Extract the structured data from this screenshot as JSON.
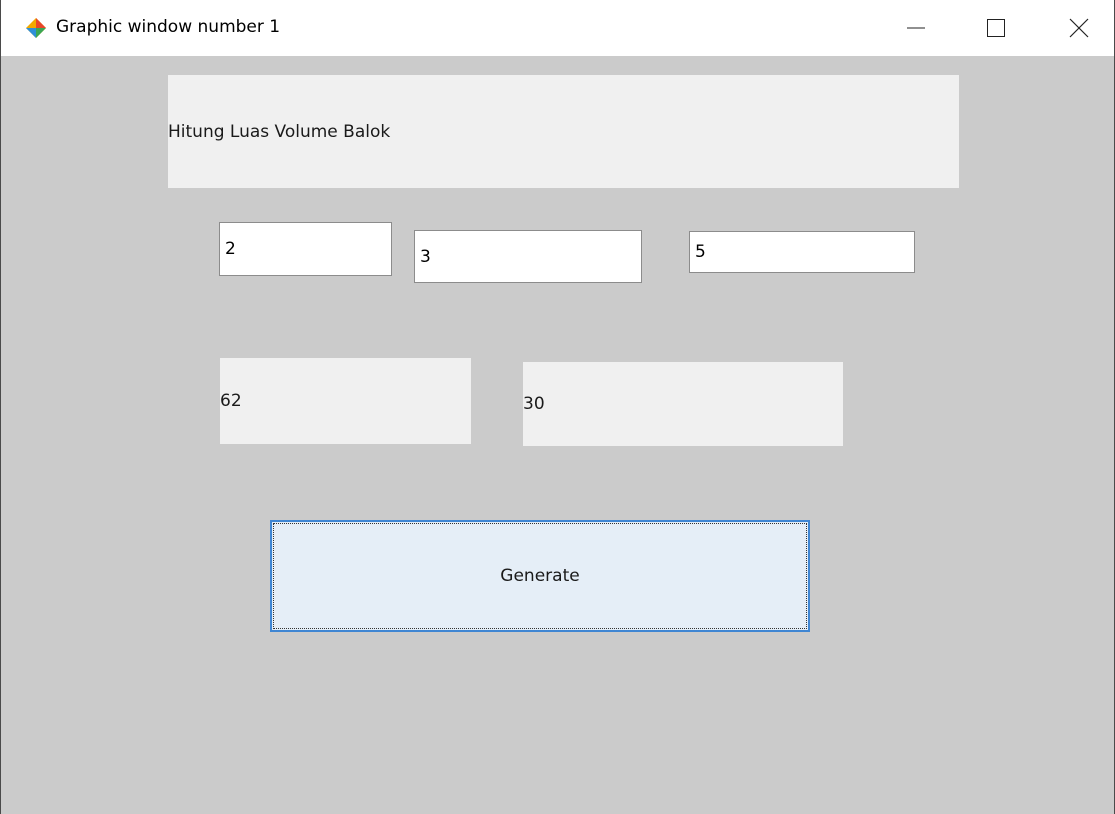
{
  "window": {
    "title": "Graphic window number 1",
    "icon": "scilab-diamond-icon",
    "controls": {
      "minimize": "minimize-icon",
      "maximize": "maximize-icon",
      "close": "close-icon"
    }
  },
  "main": {
    "heading": "Hitung Luas Volume Balok",
    "inputs": [
      {
        "value": "2"
      },
      {
        "value": "3"
      },
      {
        "value": "5"
      }
    ],
    "results": [
      {
        "value": "62"
      },
      {
        "value": "30"
      }
    ],
    "generate_label": "Generate"
  },
  "colors": {
    "canvas": "#cbcbcb",
    "frame": "#f0f0f0",
    "button_fill": "#e5eef7",
    "button_border": "#3f86d3"
  }
}
